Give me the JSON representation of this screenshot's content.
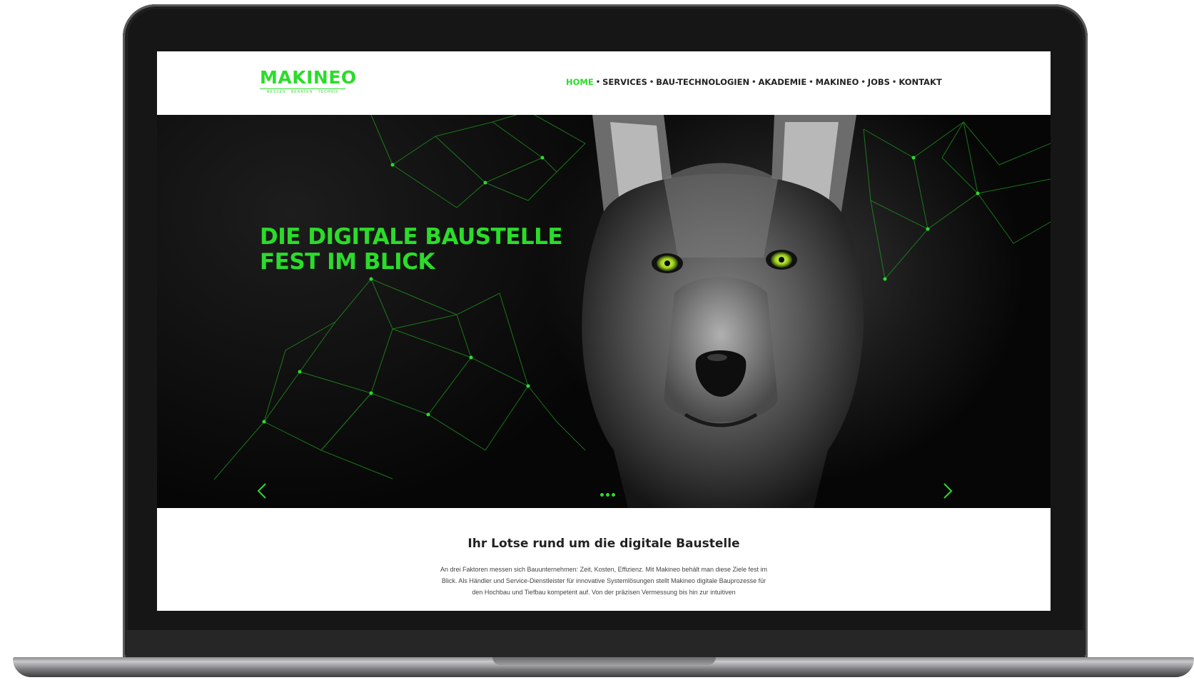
{
  "brand": {
    "logo": "MAKINEO",
    "tagline": "MESSEN · BERATEN · TECHNIK",
    "accent": "#2bdc2b"
  },
  "nav": {
    "items": [
      "HOME",
      "SERVICES",
      "BAU-TECHNOLOGIEN",
      "AKADEMIE",
      "MAKINEO",
      "JOBS",
      "KONTAKT"
    ],
    "separator": "•",
    "active": "HOME"
  },
  "hero": {
    "title_line1": "DIE DIGITALE BAUSTELLE",
    "title_line2": "FEST IM BLICK",
    "image": "wolf-portrait",
    "slides": 3,
    "prev_icon": "chevron-left-icon",
    "next_icon": "chevron-right-icon"
  },
  "intro": {
    "title": "Ihr Lotse rund um die digitale Baustelle",
    "text": "An drei Faktoren messen sich Bauunternehmen: Zeit, Kosten, Effizienz. Mit Makineo behält man diese Ziele fest im Blick. Als Händler und Service-Dienstleister für innovative Systemlösungen stellt Makineo digitale Bauprozesse für den Hochbau und Tiefbau kompetent auf. Von der präzisen Vermessung bis hin zur intuitiven"
  }
}
